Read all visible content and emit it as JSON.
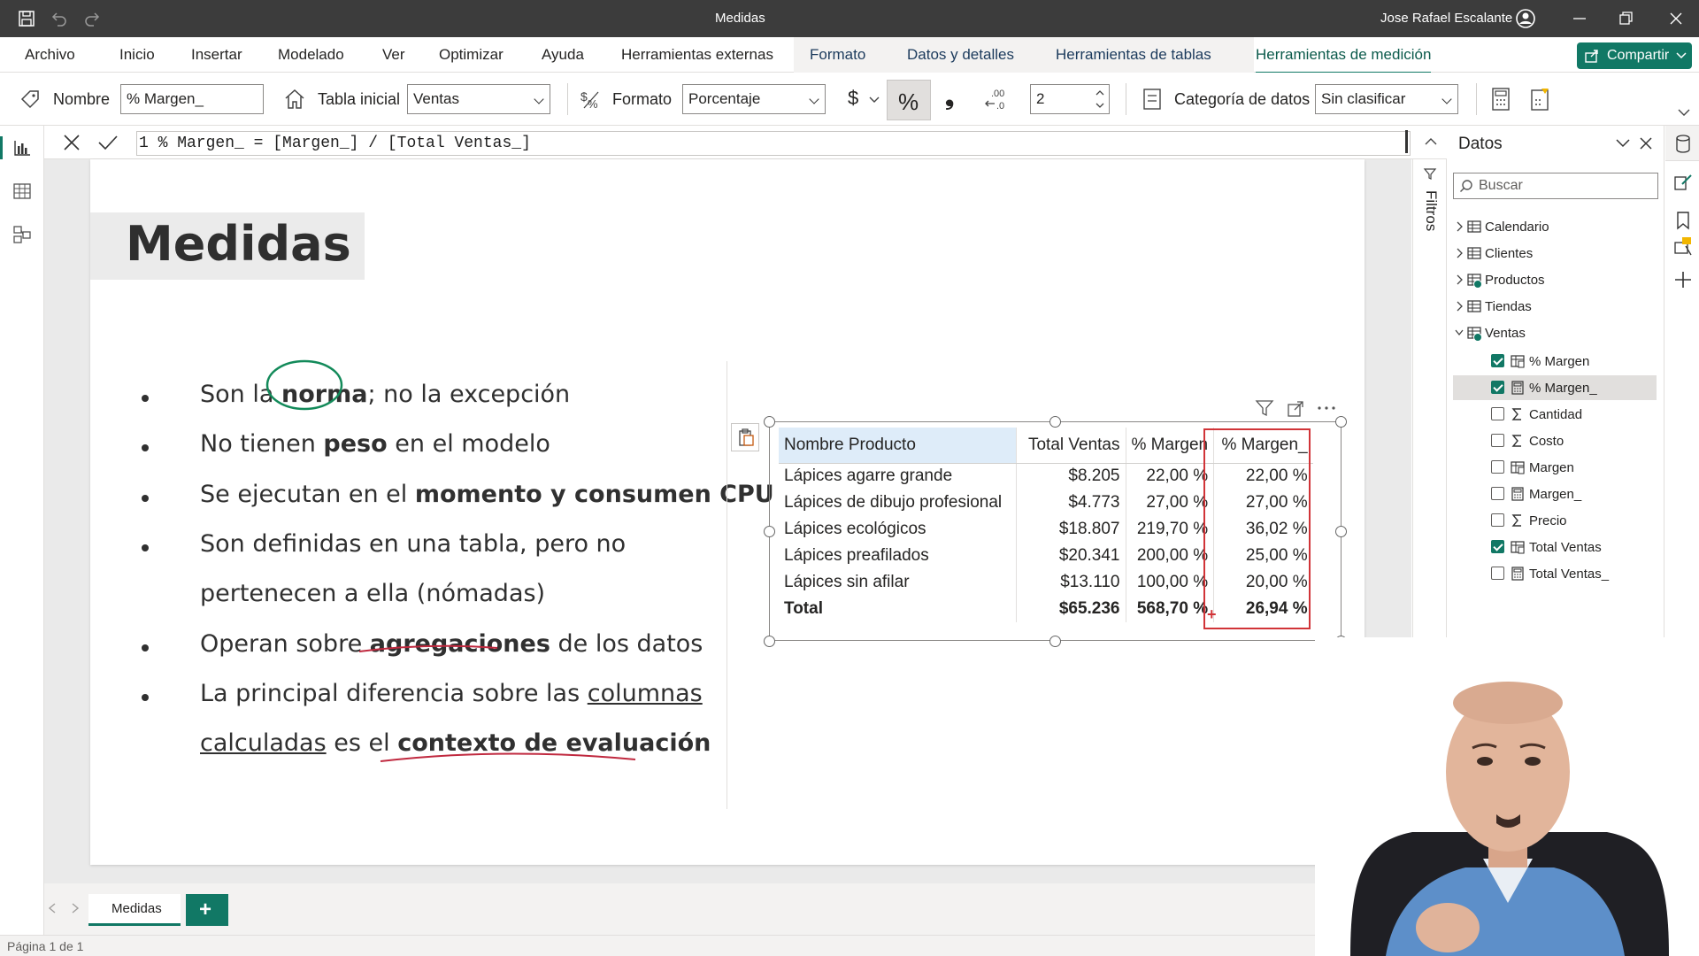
{
  "titlebar": {
    "document_title": "Medidas",
    "user_name": "Jose Rafael Escalante"
  },
  "ribbon": {
    "tabs": [
      "Archivo",
      "Inicio",
      "Insertar",
      "Modelado",
      "Ver",
      "Optimizar",
      "Ayuda",
      "Herramientas externas",
      "Formato",
      "Datos y detalles",
      "Herramientas de tablas",
      "Herramientas de medición"
    ],
    "share_label": "Compartir"
  },
  "toolbar": {
    "name_label": "Nombre",
    "name_value": "% Margen_",
    "home_table_label": "Tabla inicial",
    "home_table_value": "Ventas",
    "format_label": "Formato",
    "format_value": "Porcentaje",
    "currency_symbol": "$",
    "percent_symbol": "%",
    "comma_symbol": "❟",
    "decimals_value": "2",
    "data_category_label": "Categoría de datos",
    "data_category_value": "Sin clasificar"
  },
  "formula": {
    "text": "1 % Margen_ = [Margen_] / [Total Ventas_]"
  },
  "slide": {
    "title": "Medidas",
    "bullets": [
      {
        "parts": [
          {
            "t": "Son la ",
            "s": ""
          },
          {
            "t": "norma",
            "s": "b"
          },
          {
            "t": "; no la excepción",
            "s": ""
          }
        ]
      },
      {
        "parts": [
          {
            "t": "No tienen ",
            "s": ""
          },
          {
            "t": "peso",
            "s": "b"
          },
          {
            "t": " en el modelo",
            "s": ""
          }
        ]
      },
      {
        "parts": [
          {
            "t": "Se ejecutan en el ",
            "s": ""
          },
          {
            "t": "momento y consumen CPU",
            "s": "b"
          }
        ]
      },
      {
        "parts": [
          {
            "t": "Son definidas en una tabla, pero no",
            "s": ""
          }
        ]
      },
      {
        "parts": [
          {
            "t": "pertenecen a ella (nómadas)",
            "s": ""
          }
        ]
      },
      {
        "parts": [
          {
            "t": "Operan sobre ",
            "s": ""
          },
          {
            "t": "agregaciones",
            "s": "b"
          },
          {
            "t": " de los datos",
            "s": ""
          }
        ]
      },
      {
        "parts": [
          {
            "t": "La principal diferencia sobre las ",
            "s": ""
          },
          {
            "t": "columnas",
            "s": "u"
          }
        ]
      },
      {
        "parts": [
          {
            "t": "calculadas",
            "s": "u"
          },
          {
            "t": " es el ",
            "s": ""
          },
          {
            "t": "contexto de evaluación",
            "s": "b"
          }
        ]
      }
    ]
  },
  "table": {
    "columns": [
      "Nombre Producto",
      "Total Ventas",
      "% Margen",
      "% Margen_"
    ],
    "rows": [
      [
        "Lápices agarre grande",
        "$8.205",
        "22,00 %",
        "22,00 %"
      ],
      [
        "Lápices de dibujo profesional",
        "$4.773",
        "27,00 %",
        "27,00 %"
      ],
      [
        "Lápices ecológicos",
        "$18.807",
        "219,70 %",
        "36,02 %"
      ],
      [
        "Lápices preafilados",
        "$20.341",
        "200,00 %",
        "25,00 %"
      ],
      [
        "Lápices sin afilar",
        "$13.110",
        "100,00 %",
        "20,00 %"
      ]
    ],
    "total": [
      "Total",
      "$65.236",
      "568,70 %",
      "26,94 %"
    ]
  },
  "filters_label": "Filtros",
  "data_pane": {
    "title": "Datos",
    "search_placeholder": "Buscar",
    "tables": [
      {
        "name": "Calendario"
      },
      {
        "name": "Clientes"
      },
      {
        "name": "Productos"
      },
      {
        "name": "Tiendas"
      },
      {
        "name": "Ventas"
      }
    ],
    "ventas_fields": [
      {
        "name": "% Margen",
        "checked": true,
        "kind": "measure"
      },
      {
        "name": "% Margen_",
        "checked": true,
        "kind": "calc",
        "selected": true
      },
      {
        "name": "Cantidad",
        "checked": false,
        "kind": "sum"
      },
      {
        "name": "Costo",
        "checked": false,
        "kind": "sum"
      },
      {
        "name": "Margen",
        "checked": false,
        "kind": "measure"
      },
      {
        "name": "Margen_",
        "checked": false,
        "kind": "calc"
      },
      {
        "name": "Precio",
        "checked": false,
        "kind": "sum"
      },
      {
        "name": "Total Ventas",
        "checked": true,
        "kind": "measure"
      },
      {
        "name": "Total Ventas_",
        "checked": false,
        "kind": "calc"
      }
    ]
  },
  "pages": {
    "tab_label": "Medidas",
    "add_label": "+"
  },
  "status": {
    "page_info": "Página 1 de 1"
  },
  "colors": {
    "accent": "#117865",
    "highlight_box": "#d13438",
    "titlebar": "#3c3c3c"
  }
}
